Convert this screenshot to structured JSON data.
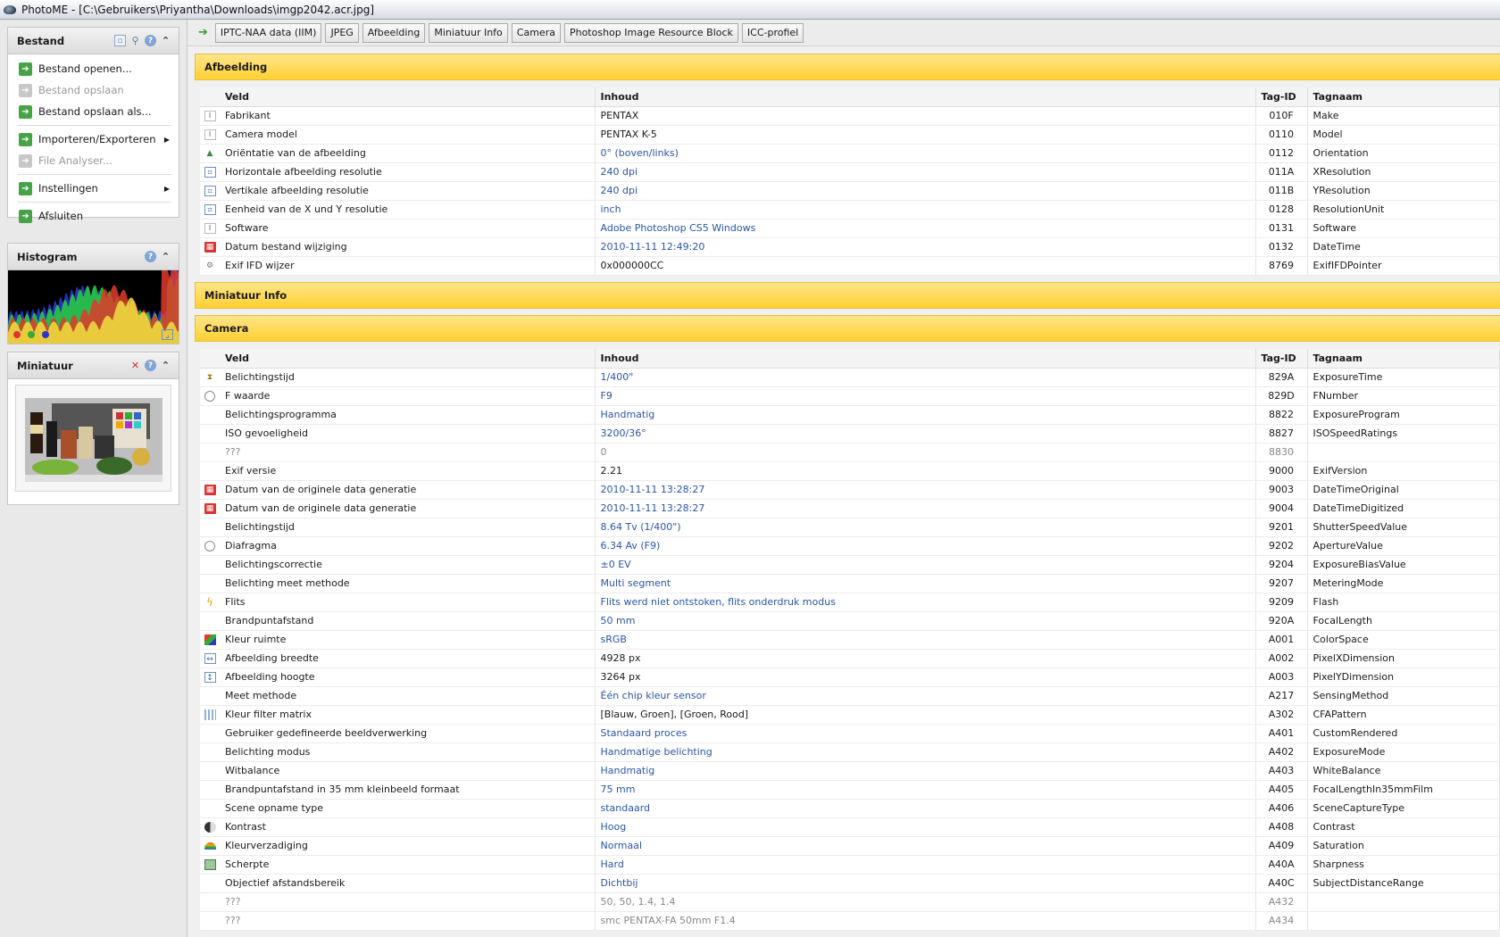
{
  "window": {
    "title": "PhotoME - [C:\\Gebruikers\\Priyantha\\Downloads\\imgp2042.acr.jpg]"
  },
  "sidebar": {
    "bestand": {
      "title": "Bestand",
      "items": [
        {
          "label": "Bestand openen...",
          "enabled": true
        },
        {
          "label": "Bestand opslaan",
          "enabled": false
        },
        {
          "label": "Bestand opslaan als...",
          "enabled": true
        },
        {
          "label": "Importeren/Exporteren",
          "enabled": true,
          "submenu": true
        },
        {
          "label": "File Analyser...",
          "enabled": false
        },
        {
          "label": "Instellingen",
          "enabled": true,
          "submenu": true
        },
        {
          "label": "Afsluiten",
          "enabled": true
        }
      ]
    },
    "histogram": {
      "title": "Histogram"
    },
    "miniatuur": {
      "title": "Miniatuur"
    }
  },
  "tabs": [
    "IPTC-NAA data (IIM)",
    "JPEG",
    "Afbeelding",
    "Miniatuur Info",
    "Camera",
    "Photoshop Image Resource Block",
    "ICC-profiel"
  ],
  "columns": {
    "veld": "Veld",
    "inhoud": "Inhoud",
    "tagid": "Tag-ID",
    "tagnaam": "Tagnaam"
  },
  "sections": {
    "afbeelding": {
      "title": "Afbeelding",
      "rows": [
        {
          "icon": "text-icon",
          "veld": "Fabrikant",
          "inhoud": "PENTAX",
          "tagid": "010F",
          "tagnaam": "Make",
          "link": false
        },
        {
          "icon": "text-icon",
          "veld": "Camera model",
          "inhoud": "PENTAX K-5",
          "tagid": "0110",
          "tagnaam": "Model",
          "link": false
        },
        {
          "icon": "orientation-icon",
          "veld": "Oriëntatie van de afbeelding",
          "inhoud": "0° (boven/links)",
          "tagid": "0112",
          "tagnaam": "Orientation",
          "link": true
        },
        {
          "icon": "resolution-icon",
          "veld": "Horizontale afbeelding resolutie",
          "inhoud": "240 dpi",
          "tagid": "011A",
          "tagnaam": "XResolution",
          "link": true
        },
        {
          "icon": "resolution-icon",
          "veld": "Vertikale afbeelding resolutie",
          "inhoud": "240 dpi",
          "tagid": "011B",
          "tagnaam": "YResolution",
          "link": true
        },
        {
          "icon": "resolution-icon",
          "veld": "Eenheid van de X und Y resolutie",
          "inhoud": "inch",
          "tagid": "0128",
          "tagnaam": "ResolutionUnit",
          "link": true
        },
        {
          "icon": "text-icon",
          "veld": "Software",
          "inhoud": "Adobe Photoshop CS5 Windows",
          "tagid": "0131",
          "tagnaam": "Software",
          "link": true
        },
        {
          "icon": "calendar-icon",
          "veld": "Datum bestand wijziging",
          "inhoud": "2010-11-11 12:49:20",
          "tagid": "0132",
          "tagnaam": "DateTime",
          "link": true
        },
        {
          "icon": "gear-icon",
          "veld": "Exif IFD wijzer",
          "inhoud": "0x000000CC",
          "tagid": "8769",
          "tagnaam": "ExifIFDPointer",
          "link": false
        }
      ]
    },
    "miniatuur_info": {
      "title": "Miniatuur Info"
    },
    "camera": {
      "title": "Camera",
      "rows": [
        {
          "icon": "hourglass-icon",
          "veld": "Belichtingstijd",
          "inhoud": "1/400\"",
          "tagid": "829A",
          "tagnaam": "ExposureTime",
          "link": true
        },
        {
          "icon": "aperture-icon",
          "veld": "F waarde",
          "inhoud": "F9",
          "tagid": "829D",
          "tagnaam": "FNumber",
          "link": true
        },
        {
          "icon": "",
          "veld": "Belichtingsprogramma",
          "inhoud": "Handmatig",
          "tagid": "8822",
          "tagnaam": "ExposureProgram",
          "link": true
        },
        {
          "icon": "",
          "veld": "ISO gevoeligheid",
          "inhoud": "3200/36°",
          "tagid": "8827",
          "tagnaam": "ISOSpeedRatings",
          "link": true
        },
        {
          "icon": "",
          "veld": "???",
          "inhoud": "0",
          "tagid": "8830",
          "tagnaam": "",
          "link": false,
          "unknown": true
        },
        {
          "icon": "",
          "veld": "Exif versie",
          "inhoud": "2.21",
          "tagid": "9000",
          "tagnaam": "ExifVersion",
          "link": false
        },
        {
          "icon": "calendar-icon",
          "veld": "Datum van de originele data generatie",
          "inhoud": "2010-11-11 13:28:27",
          "tagid": "9003",
          "tagnaam": "DateTimeOriginal",
          "link": true
        },
        {
          "icon": "calendar-icon",
          "veld": "Datum van de originele data generatie",
          "inhoud": "2010-11-11 13:28:27",
          "tagid": "9004",
          "tagnaam": "DateTimeDigitized",
          "link": true
        },
        {
          "icon": "",
          "veld": "Belichtingstijd",
          "inhoud": "8.64 Tv (1/400\")",
          "tagid": "9201",
          "tagnaam": "ShutterSpeedValue",
          "link": true
        },
        {
          "icon": "aperture-icon",
          "veld": "Diafragma",
          "inhoud": "6.34 Av (F9)",
          "tagid": "9202",
          "tagnaam": "ApertureValue",
          "link": true
        },
        {
          "icon": "",
          "veld": "Belichtingscorrectie",
          "inhoud": "±0 EV",
          "tagid": "9204",
          "tagnaam": "ExposureBiasValue",
          "link": true
        },
        {
          "icon": "",
          "veld": "Belichting meet methode",
          "inhoud": "Multi segment",
          "tagid": "9207",
          "tagnaam": "MeteringMode",
          "link": true
        },
        {
          "icon": "flash-icon",
          "veld": "Flits",
          "inhoud": "Flits werd niet ontstoken, flits onderdruk modus",
          "tagid": "9209",
          "tagnaam": "Flash",
          "link": true
        },
        {
          "icon": "",
          "veld": "Brandpuntafstand",
          "inhoud": "50 mm",
          "tagid": "920A",
          "tagnaam": "FocalLength",
          "link": true
        },
        {
          "icon": "color-cube-icon",
          "veld": "Kleur ruimte",
          "inhoud": "sRGB",
          "tagid": "A001",
          "tagnaam": "ColorSpace",
          "link": true
        },
        {
          "icon": "width-icon",
          "veld": "Afbeelding breedte",
          "inhoud": "4928 px",
          "tagid": "A002",
          "tagnaam": "PixelXDimension",
          "link": false
        },
        {
          "icon": "height-icon",
          "veld": "Afbeelding hoogte",
          "inhoud": "3264 px",
          "tagid": "A003",
          "tagnaam": "PixelYDimension",
          "link": false
        },
        {
          "icon": "",
          "veld": "Meet methode",
          "inhoud": "Één chip kleur sensor",
          "tagid": "A217",
          "tagnaam": "SensingMethod",
          "link": true
        },
        {
          "icon": "filter-grid-icon",
          "veld": "Kleur filter matrix",
          "inhoud": "[Blauw, Groen], [Groen, Rood]",
          "tagid": "A302",
          "tagnaam": "CFAPattern",
          "link": false
        },
        {
          "icon": "",
          "veld": "Gebruiker gedefineerde beeldverwerking",
          "inhoud": "Standaard proces",
          "tagid": "A401",
          "tagnaam": "CustomRendered",
          "link": true
        },
        {
          "icon": "",
          "veld": "Belichting modus",
          "inhoud": "Handmatige belichting",
          "tagid": "A402",
          "tagnaam": "ExposureMode",
          "link": true
        },
        {
          "icon": "",
          "veld": "Witbalance",
          "inhoud": "Handmatig",
          "tagid": "A403",
          "tagnaam": "WhiteBalance",
          "link": true
        },
        {
          "icon": "",
          "veld": "Brandpuntafstand in 35 mm kleinbeeld formaat",
          "inhoud": "75 mm",
          "tagid": "A405",
          "tagnaam": "FocalLengthIn35mmFilm",
          "link": true
        },
        {
          "icon": "",
          "veld": "Scene opname type",
          "inhoud": "standaard",
          "tagid": "A406",
          "tagnaam": "SceneCaptureType",
          "link": true
        },
        {
          "icon": "contrast-icon",
          "veld": "Kontrast",
          "inhoud": "Hoog",
          "tagid": "A408",
          "tagnaam": "Contrast",
          "link": true
        },
        {
          "icon": "rainbow-icon",
          "veld": "Kleurverzadiging",
          "inhoud": "Normaal",
          "tagid": "A409",
          "tagnaam": "Saturation",
          "link": true
        },
        {
          "icon": "sharpness-icon",
          "veld": "Scherpte",
          "inhoud": "Hard",
          "tagid": "A40A",
          "tagnaam": "Sharpness",
          "link": true
        },
        {
          "icon": "",
          "veld": "Objectief afstandsbereik",
          "inhoud": "Dichtbij",
          "tagid": "A40C",
          "tagnaam": "SubjectDistanceRange",
          "link": true
        },
        {
          "icon": "",
          "veld": "???",
          "inhoud": "50, 50, 1.4, 1.4",
          "tagid": "A432",
          "tagnaam": "",
          "link": false,
          "unknown": true
        },
        {
          "icon": "",
          "veld": "???",
          "inhoud": "smc PENTAX-FA 50mm F1.4",
          "tagid": "A434",
          "tagnaam": "",
          "link": false,
          "unknown": true
        }
      ]
    }
  },
  "colors": {
    "section_header": "#ffd030",
    "link": "#2a55a8",
    "menu_icon": "#46a447"
  }
}
